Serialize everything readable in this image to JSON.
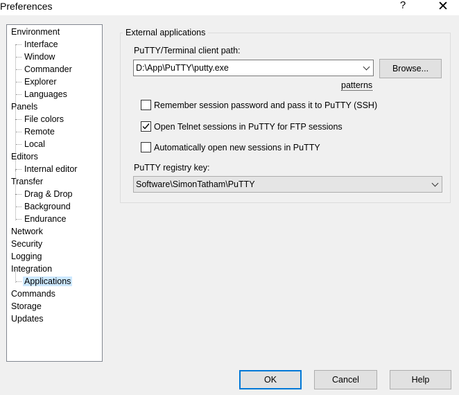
{
  "window": {
    "title": "Preferences",
    "help_glyph": "?",
    "close_glyph": "✕"
  },
  "tree": {
    "items": [
      {
        "label": "Environment",
        "level": 0
      },
      {
        "label": "Interface",
        "level": 1
      },
      {
        "label": "Window",
        "level": 1
      },
      {
        "label": "Commander",
        "level": 1
      },
      {
        "label": "Explorer",
        "level": 1
      },
      {
        "label": "Languages",
        "level": 1
      },
      {
        "label": "Panels",
        "level": 0
      },
      {
        "label": "File colors",
        "level": 1
      },
      {
        "label": "Remote",
        "level": 1
      },
      {
        "label": "Local",
        "level": 1
      },
      {
        "label": "Editors",
        "level": 0
      },
      {
        "label": "Internal editor",
        "level": 1
      },
      {
        "label": "Transfer",
        "level": 0
      },
      {
        "label": "Drag & Drop",
        "level": 1
      },
      {
        "label": "Background",
        "level": 1
      },
      {
        "label": "Endurance",
        "level": 1
      },
      {
        "label": "Network",
        "level": 0
      },
      {
        "label": "Security",
        "level": 0
      },
      {
        "label": "Logging",
        "level": 0
      },
      {
        "label": "Integration",
        "level": 0
      },
      {
        "label": "Applications",
        "level": 1,
        "selected": true
      },
      {
        "label": "Commands",
        "level": 0
      },
      {
        "label": "Storage",
        "level": 0
      },
      {
        "label": "Updates",
        "level": 0
      }
    ]
  },
  "external_apps": {
    "group_title": "External applications",
    "putty_path_label": "PuTTY/Terminal client path:",
    "putty_path_value": "D:\\App\\PuTTY\\putty.exe",
    "browse_label": "Browse...",
    "patterns_label": "patterns",
    "checkboxes": [
      {
        "label": "Remember session password and pass it to PuTTY (SSH)",
        "checked": false
      },
      {
        "label": "Open Telnet sessions in PuTTY for FTP sessions",
        "checked": true
      },
      {
        "label": "Automatically open new sessions in PuTTY",
        "checked": false
      }
    ],
    "registry_label": "PuTTY registry key:",
    "registry_value": "Software\\SimonTatham\\PuTTY"
  },
  "buttons": {
    "ok": "OK",
    "cancel": "Cancel",
    "help": "Help"
  }
}
